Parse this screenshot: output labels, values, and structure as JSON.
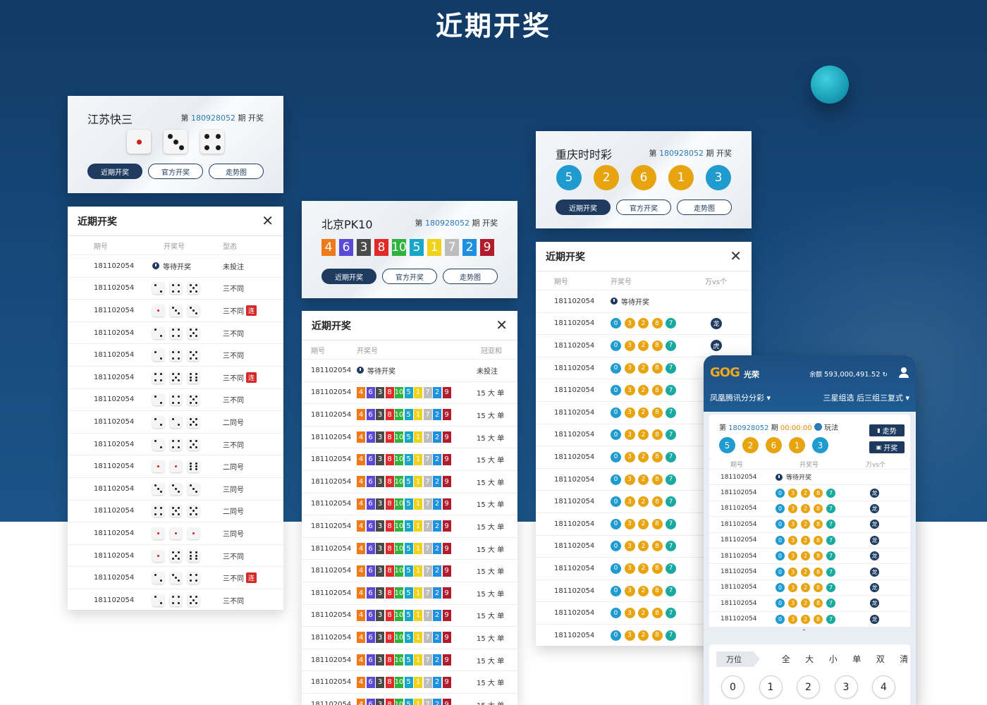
{
  "title": "近期开奖",
  "common": {
    "issue_prefix": "第",
    "issue_no": "180928052",
    "issue_suffix": "期 开奖",
    "btn_recent": "近期开奖",
    "btn_official": "官方开奖",
    "btn_trend": "走势图",
    "panel_title": "近期开奖",
    "close": "✕",
    "pending": "等待开奖"
  },
  "colors": {
    "navy": "#1e3a5f",
    "blue_ball": "#1f9bcf",
    "orange_ball": "#e8a40f",
    "green_ball": "#18a9a0",
    "red": "#d42a2a"
  },
  "k3": {
    "name": "江苏快三",
    "dice": [
      1,
      3,
      4
    ],
    "headers": [
      "期号",
      "开奖号",
      "型态"
    ],
    "rows": [
      {
        "issue": "181102054",
        "pending": true,
        "status": "未投注"
      },
      {
        "issue": "181102054",
        "dice": [
          2,
          4,
          5
        ],
        "status": "三不同"
      },
      {
        "issue": "181102054",
        "dice": [
          1,
          3,
          3
        ],
        "status": "三不同",
        "tag": "连"
      },
      {
        "issue": "181102054",
        "dice": [
          2,
          4,
          5
        ],
        "status": "三不同"
      },
      {
        "issue": "181102054",
        "dice": [
          2,
          4,
          5
        ],
        "status": "三不同"
      },
      {
        "issue": "181102054",
        "dice": [
          4,
          5,
          6
        ],
        "status": "三不同",
        "tag": "连"
      },
      {
        "issue": "181102054",
        "dice": [
          2,
          4,
          5
        ],
        "status": "三不同"
      },
      {
        "issue": "181102054",
        "dice": [
          2,
          2,
          5
        ],
        "status": "二同号"
      },
      {
        "issue": "181102054",
        "dice": [
          2,
          4,
          5
        ],
        "status": "三不同"
      },
      {
        "issue": "181102054",
        "dice": [
          1,
          1,
          6
        ],
        "status": "二同号"
      },
      {
        "issue": "181102054",
        "dice": [
          3,
          3,
          3
        ],
        "status": "三同号"
      },
      {
        "issue": "181102054",
        "dice": [
          4,
          5,
          5
        ],
        "status": "二同号"
      },
      {
        "issue": "181102054",
        "dice": [
          1,
          1,
          1
        ],
        "status": "三同号"
      },
      {
        "issue": "181102054",
        "dice": [
          1,
          5,
          6
        ],
        "status": "三不同"
      },
      {
        "issue": "181102054",
        "dice": [
          2,
          3,
          4
        ],
        "status": "三不同",
        "tag": "连"
      },
      {
        "issue": "181102054",
        "dice": [
          2,
          4,
          5
        ],
        "status": "三不同"
      }
    ]
  },
  "pk10": {
    "name": "北京PK10",
    "numbers": [
      "4",
      "6",
      "3",
      "8",
      "10",
      "5",
      "1",
      "7",
      "2",
      "9"
    ],
    "headers": [
      "期号",
      "开奖号",
      "冠亚和"
    ],
    "pending_status": "未投注",
    "result": "15 大 单",
    "row_issue": "181102054",
    "row_count": 15,
    "last_issue": "181102054",
    "num_colors": {
      "1": "#f0d21a",
      "2": "#1f8fe0",
      "3": "#4a4a4a",
      "4": "#ee7a1a",
      "5": "#1aa6c6",
      "6": "#5b48d6",
      "7": "#bdbdbd",
      "8": "#e02a2a",
      "9": "#b01c2c",
      "10": "#2fb33d"
    }
  },
  "ssc": {
    "name": "重庆时时彩",
    "balls": [
      "5",
      "2",
      "6",
      "1",
      "3"
    ],
    "ball_colors": [
      "blue",
      "orange",
      "orange",
      "orange",
      "blue"
    ],
    "headers": [
      "期号",
      "开奖号",
      "万vs个"
    ],
    "row_issue": "181102054",
    "row_balls": [
      "0",
      "3",
      "2",
      "8",
      "7"
    ],
    "row_ball_colors": [
      "blue",
      "orange",
      "orange",
      "orange",
      "green"
    ],
    "tags": [
      "龙",
      "虎",
      "",
      "",
      "",
      "",
      "",
      "",
      "",
      "",
      "",
      "",
      "",
      "",
      "",
      ""
    ],
    "row_count": 15
  },
  "phone": {
    "logo": "GOG",
    "logo_text": "光荣",
    "balance_label": "余额",
    "balance": "593,000,491.52",
    "refresh": "↻",
    "game": "凤凰腾讯分分彩 ▾",
    "mode": "三星组选 后三组三复式 ▾",
    "issue_prefix": "第",
    "issue_no": "180928052",
    "issue_mid": "期",
    "time": "00:00:00",
    "play": "玩法",
    "trend_btn": "走势",
    "draw_btn": "开奖",
    "balls": [
      "5",
      "2",
      "6",
      "1",
      "3"
    ],
    "headers": [
      "期号",
      "开奖号",
      "万vs个"
    ],
    "row_issue": "181102054",
    "row_balls": [
      "0",
      "3",
      "2",
      "8",
      "7"
    ],
    "tag": "龙",
    "row_count": 9,
    "caret": "⌃",
    "position": "万位",
    "quick": [
      "全",
      "大",
      "小",
      "单",
      "双",
      "清"
    ],
    "keys": [
      "0",
      "1",
      "2",
      "3",
      "4"
    ]
  }
}
